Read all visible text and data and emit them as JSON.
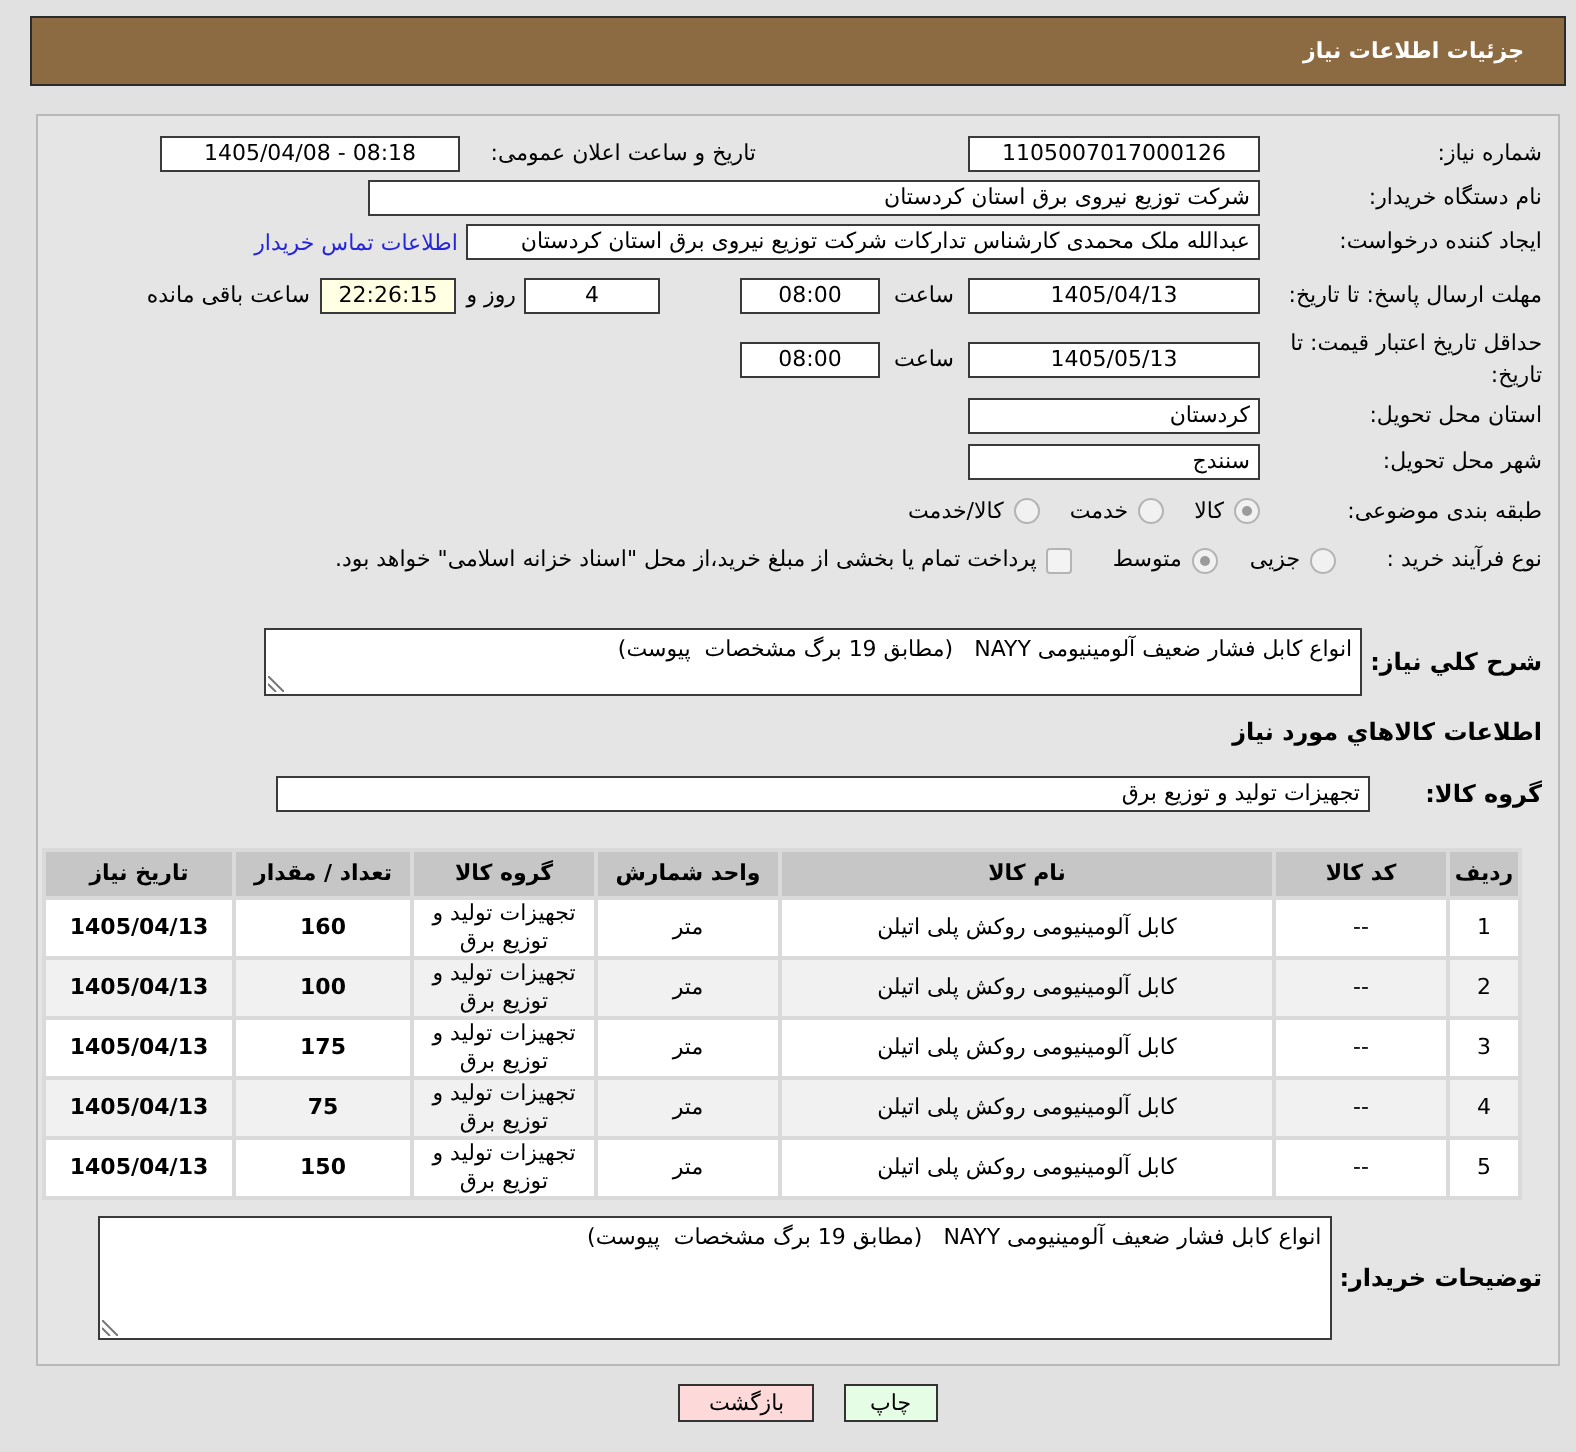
{
  "header": {
    "title": "جزئیات اطلاعات نیاز"
  },
  "need_number": {
    "label": "شماره نیاز:",
    "value": "1105007017000126"
  },
  "announcement": {
    "label": "تاریخ و ساعت اعلان عمومی:",
    "value": "1405/04/08 - 08:18"
  },
  "buyer_org": {
    "label": "نام دستگاه خریدار:",
    "value": "شرکت توزیع نیروی برق استان کردستان"
  },
  "requester": {
    "label": "ایجاد کننده درخواست:",
    "value": "عبدالله ملک محمدی کارشناس تدارکات شرکت توزیع نیروی برق استان کردستان",
    "link": "اطلاعات تماس خریدار"
  },
  "reply_deadline": {
    "label": "مهلت ارسال پاسخ: تا تاریخ:",
    "date": "1405/04/13",
    "time_label": "ساعت",
    "time": "08:00",
    "days": "4",
    "days_label": "روز و",
    "remaining": "22:26:15",
    "remaining_label": "ساعت باقی مانده"
  },
  "price_validity": {
    "label": "حداقل تاریخ اعتبار قیمت: تا تاریخ:",
    "date": "1405/05/13",
    "time_label": "ساعت",
    "time": "08:00"
  },
  "delivery_province": {
    "label": "استان محل تحویل:",
    "value": "کردستان"
  },
  "delivery_city": {
    "label": "شهر محل تحویل:",
    "value": "سنندج"
  },
  "subject_category": {
    "label": "طبقه بندی موضوعی:",
    "options": [
      {
        "label": "کالا",
        "selected": true
      },
      {
        "label": "خدمت",
        "selected": false
      },
      {
        "label": "کالا/خدمت",
        "selected": false
      }
    ]
  },
  "purchase_process": {
    "label": "نوع فرآیند خرید :",
    "options": [
      {
        "label": "جزیی",
        "selected": false
      },
      {
        "label": "متوسط",
        "selected": true
      }
    ],
    "treasury_payment": {
      "label": "پرداخت تمام یا بخشی از مبلغ خرید،از محل \"اسناد خزانه اسلامی\" خواهد بود.",
      "checked": false
    }
  },
  "general_description": {
    "label": "شرح کلي نیاز:",
    "value": "انواع کابل فشار ضعیف آلومینیومی NAYY   (مطابق 19 برگ مشخصات  پیوست)"
  },
  "goods_section": {
    "title": "اطلاعات کالاهاي مورد نیاز"
  },
  "goods_group": {
    "label": "گروه کالا:",
    "value": "تجهیزات تولید و توزیع برق"
  },
  "table": {
    "columns": [
      "ردیف",
      "کد کالا",
      "نام کالا",
      "واحد شمارش",
      "گروه کالا",
      "تعداد / مقدار",
      "تاریخ نیاز"
    ],
    "rows": [
      [
        "1",
        "--",
        "کابل آلومینیومی روکش پلی اتیلن",
        "متر",
        "تجهیزات تولید و توزیع برق",
        "160",
        "1405/04/13"
      ],
      [
        "2",
        "--",
        "کابل آلومینیومی روکش پلی اتیلن",
        "متر",
        "تجهیزات تولید و توزیع برق",
        "100",
        "1405/04/13"
      ],
      [
        "3",
        "--",
        "کابل آلومینیومی روکش پلی اتیلن",
        "متر",
        "تجهیزات تولید و توزیع برق",
        "175",
        "1405/04/13"
      ],
      [
        "4",
        "--",
        "کابل آلومینیومی روکش پلی اتیلن",
        "متر",
        "تجهیزات تولید و توزیع برق",
        "75",
        "1405/04/13"
      ],
      [
        "5",
        "--",
        "کابل آلومینیومی روکش پلی اتیلن",
        "متر",
        "تجهیزات تولید و توزیع برق",
        "150",
        "1405/04/13"
      ]
    ]
  },
  "buyer_notes": {
    "label": "توضیحات خریدار:",
    "value": "انواع کابل فشار ضعیف آلومینیومی NAYY   (مطابق 19 برگ مشخصات  پیوست)"
  },
  "buttons": [
    {
      "label": "چاپ",
      "kind": "print"
    },
    {
      "label": "بازگشت",
      "kind": "back"
    }
  ]
}
